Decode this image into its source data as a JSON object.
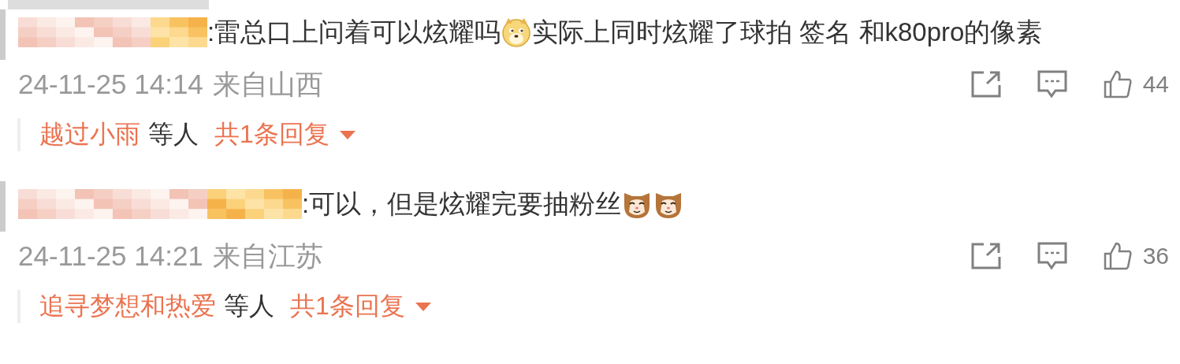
{
  "comments": [
    {
      "content": [
        {
          "kind": "text",
          "text": ":雷总口上问着可以炫耀吗"
        },
        {
          "kind": "dog-emoji"
        },
        {
          "kind": "text",
          "text": "实际上同时炫耀了球拍 签名 和k80pro的像素"
        }
      ],
      "time": "24-11-25 14:14",
      "location": "来自山西",
      "likes": "44",
      "replies": {
        "users": "越过小雨",
        "suffix": "等人",
        "total": "共1条回复",
        "expanded": false
      }
    },
    {
      "content": [
        {
          "kind": "text",
          "text": ":可以，但是炫耀完要抽粉丝"
        },
        {
          "kind": "cat-emoji"
        },
        {
          "kind": "cat-emoji"
        }
      ],
      "time": "24-11-25 14:21",
      "location": "来自江苏",
      "likes": "36",
      "replies": {
        "users": "追寻梦想和热爱",
        "suffix": "等人",
        "total": "共1条回复",
        "expanded": false
      }
    }
  ]
}
